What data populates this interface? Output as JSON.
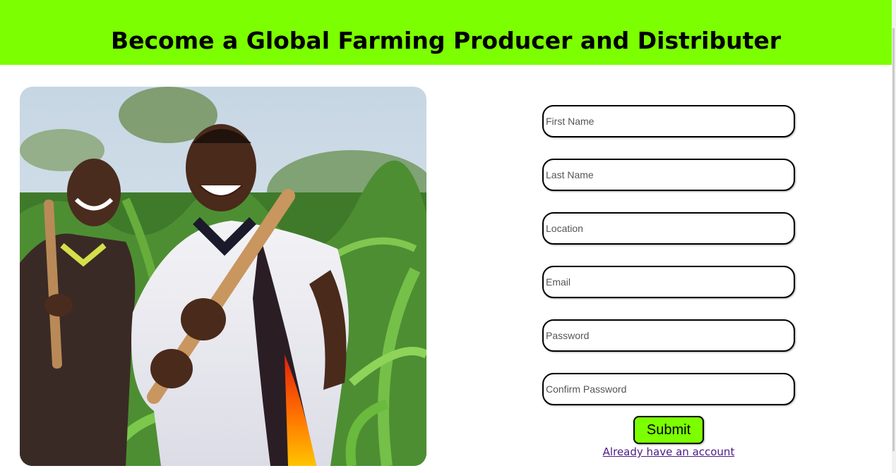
{
  "header": {
    "title": "Become a Global Farming Producer and Distributer",
    "background_color": "#7cff00"
  },
  "form": {
    "fields": [
      {
        "placeholder": "First Name",
        "value": ""
      },
      {
        "placeholder": "Last Name",
        "value": ""
      },
      {
        "placeholder": "Location",
        "value": ""
      },
      {
        "placeholder": "Email",
        "value": ""
      },
      {
        "placeholder": "Password",
        "value": ""
      },
      {
        "placeholder": "Confirm Password",
        "value": ""
      }
    ],
    "submit_label": "Submit",
    "login_link_label": "Already have an account"
  }
}
